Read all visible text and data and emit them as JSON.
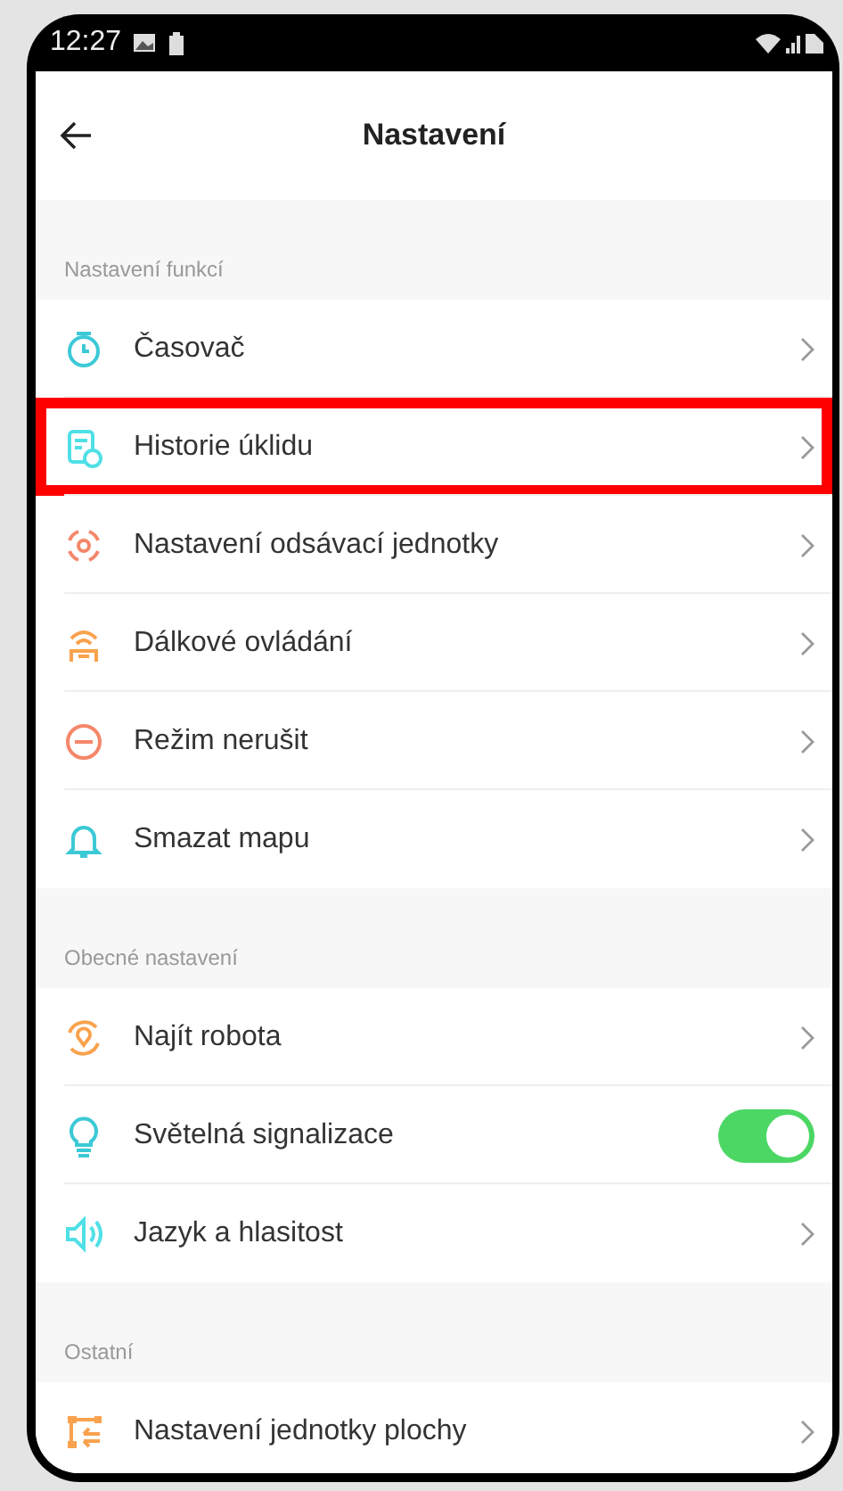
{
  "status_bar": {
    "time": "12:27"
  },
  "header": {
    "title": "Nastavení"
  },
  "sections": [
    {
      "title": "Nastavení funkcí",
      "items": [
        {
          "kind": "link",
          "label": "Časovač",
          "highlighted": false
        },
        {
          "kind": "link",
          "label": "Historie úklidu",
          "highlighted": true
        },
        {
          "kind": "link",
          "label": "Nastavení odsávací jednotky",
          "highlighted": false
        },
        {
          "kind": "link",
          "label": "Dálkové ovládání",
          "highlighted": false
        },
        {
          "kind": "link",
          "label": "Režim nerušit",
          "highlighted": false
        },
        {
          "kind": "link",
          "label": "Smazat mapu",
          "highlighted": false
        }
      ]
    },
    {
      "title": "Obecné nastavení",
      "items": [
        {
          "kind": "link",
          "label": "Najít robota",
          "highlighted": false
        },
        {
          "kind": "toggle",
          "label": "Světelná signalizace",
          "on": true,
          "highlighted": false
        },
        {
          "kind": "link",
          "label": "Jazyk a hlasitost",
          "highlighted": false
        }
      ]
    },
    {
      "title": "Ostatní",
      "items": [
        {
          "kind": "link",
          "label": "Nastavení jednotky plochy",
          "highlighted": false
        }
      ]
    }
  ]
}
